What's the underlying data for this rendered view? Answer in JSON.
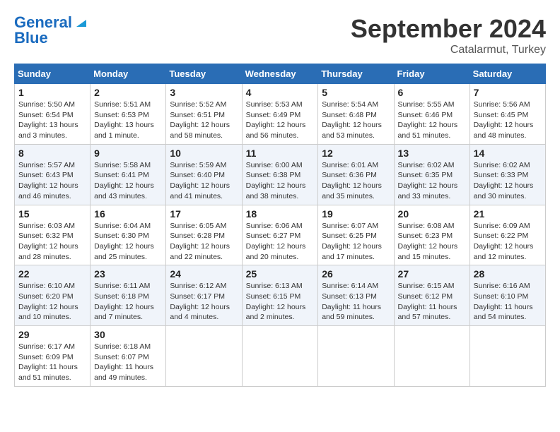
{
  "header": {
    "logo_line1": "General",
    "logo_line2": "Blue",
    "month_title": "September 2024",
    "location": "Catalarmut, Turkey"
  },
  "days_of_week": [
    "Sunday",
    "Monday",
    "Tuesday",
    "Wednesday",
    "Thursday",
    "Friday",
    "Saturday"
  ],
  "weeks": [
    [
      {
        "num": "1",
        "sunrise": "5:50 AM",
        "sunset": "6:54 PM",
        "daylight": "13 hours and 3 minutes."
      },
      {
        "num": "2",
        "sunrise": "5:51 AM",
        "sunset": "6:53 PM",
        "daylight": "13 hours and 1 minute."
      },
      {
        "num": "3",
        "sunrise": "5:52 AM",
        "sunset": "6:51 PM",
        "daylight": "12 hours and 58 minutes."
      },
      {
        "num": "4",
        "sunrise": "5:53 AM",
        "sunset": "6:49 PM",
        "daylight": "12 hours and 56 minutes."
      },
      {
        "num": "5",
        "sunrise": "5:54 AM",
        "sunset": "6:48 PM",
        "daylight": "12 hours and 53 minutes."
      },
      {
        "num": "6",
        "sunrise": "5:55 AM",
        "sunset": "6:46 PM",
        "daylight": "12 hours and 51 minutes."
      },
      {
        "num": "7",
        "sunrise": "5:56 AM",
        "sunset": "6:45 PM",
        "daylight": "12 hours and 48 minutes."
      }
    ],
    [
      {
        "num": "8",
        "sunrise": "5:57 AM",
        "sunset": "6:43 PM",
        "daylight": "12 hours and 46 minutes."
      },
      {
        "num": "9",
        "sunrise": "5:58 AM",
        "sunset": "6:41 PM",
        "daylight": "12 hours and 43 minutes."
      },
      {
        "num": "10",
        "sunrise": "5:59 AM",
        "sunset": "6:40 PM",
        "daylight": "12 hours and 41 minutes."
      },
      {
        "num": "11",
        "sunrise": "6:00 AM",
        "sunset": "6:38 PM",
        "daylight": "12 hours and 38 minutes."
      },
      {
        "num": "12",
        "sunrise": "6:01 AM",
        "sunset": "6:36 PM",
        "daylight": "12 hours and 35 minutes."
      },
      {
        "num": "13",
        "sunrise": "6:02 AM",
        "sunset": "6:35 PM",
        "daylight": "12 hours and 33 minutes."
      },
      {
        "num": "14",
        "sunrise": "6:02 AM",
        "sunset": "6:33 PM",
        "daylight": "12 hours and 30 minutes."
      }
    ],
    [
      {
        "num": "15",
        "sunrise": "6:03 AM",
        "sunset": "6:32 PM",
        "daylight": "12 hours and 28 minutes."
      },
      {
        "num": "16",
        "sunrise": "6:04 AM",
        "sunset": "6:30 PM",
        "daylight": "12 hours and 25 minutes."
      },
      {
        "num": "17",
        "sunrise": "6:05 AM",
        "sunset": "6:28 PM",
        "daylight": "12 hours and 22 minutes."
      },
      {
        "num": "18",
        "sunrise": "6:06 AM",
        "sunset": "6:27 PM",
        "daylight": "12 hours and 20 minutes."
      },
      {
        "num": "19",
        "sunrise": "6:07 AM",
        "sunset": "6:25 PM",
        "daylight": "12 hours and 17 minutes."
      },
      {
        "num": "20",
        "sunrise": "6:08 AM",
        "sunset": "6:23 PM",
        "daylight": "12 hours and 15 minutes."
      },
      {
        "num": "21",
        "sunrise": "6:09 AM",
        "sunset": "6:22 PM",
        "daylight": "12 hours and 12 minutes."
      }
    ],
    [
      {
        "num": "22",
        "sunrise": "6:10 AM",
        "sunset": "6:20 PM",
        "daylight": "12 hours and 10 minutes."
      },
      {
        "num": "23",
        "sunrise": "6:11 AM",
        "sunset": "6:18 PM",
        "daylight": "12 hours and 7 minutes."
      },
      {
        "num": "24",
        "sunrise": "6:12 AM",
        "sunset": "6:17 PM",
        "daylight": "12 hours and 4 minutes."
      },
      {
        "num": "25",
        "sunrise": "6:13 AM",
        "sunset": "6:15 PM",
        "daylight": "12 hours and 2 minutes."
      },
      {
        "num": "26",
        "sunrise": "6:14 AM",
        "sunset": "6:13 PM",
        "daylight": "11 hours and 59 minutes."
      },
      {
        "num": "27",
        "sunrise": "6:15 AM",
        "sunset": "6:12 PM",
        "daylight": "11 hours and 57 minutes."
      },
      {
        "num": "28",
        "sunrise": "6:16 AM",
        "sunset": "6:10 PM",
        "daylight": "11 hours and 54 minutes."
      }
    ],
    [
      {
        "num": "29",
        "sunrise": "6:17 AM",
        "sunset": "6:09 PM",
        "daylight": "11 hours and 51 minutes."
      },
      {
        "num": "30",
        "sunrise": "6:18 AM",
        "sunset": "6:07 PM",
        "daylight": "11 hours and 49 minutes."
      },
      null,
      null,
      null,
      null,
      null
    ]
  ]
}
